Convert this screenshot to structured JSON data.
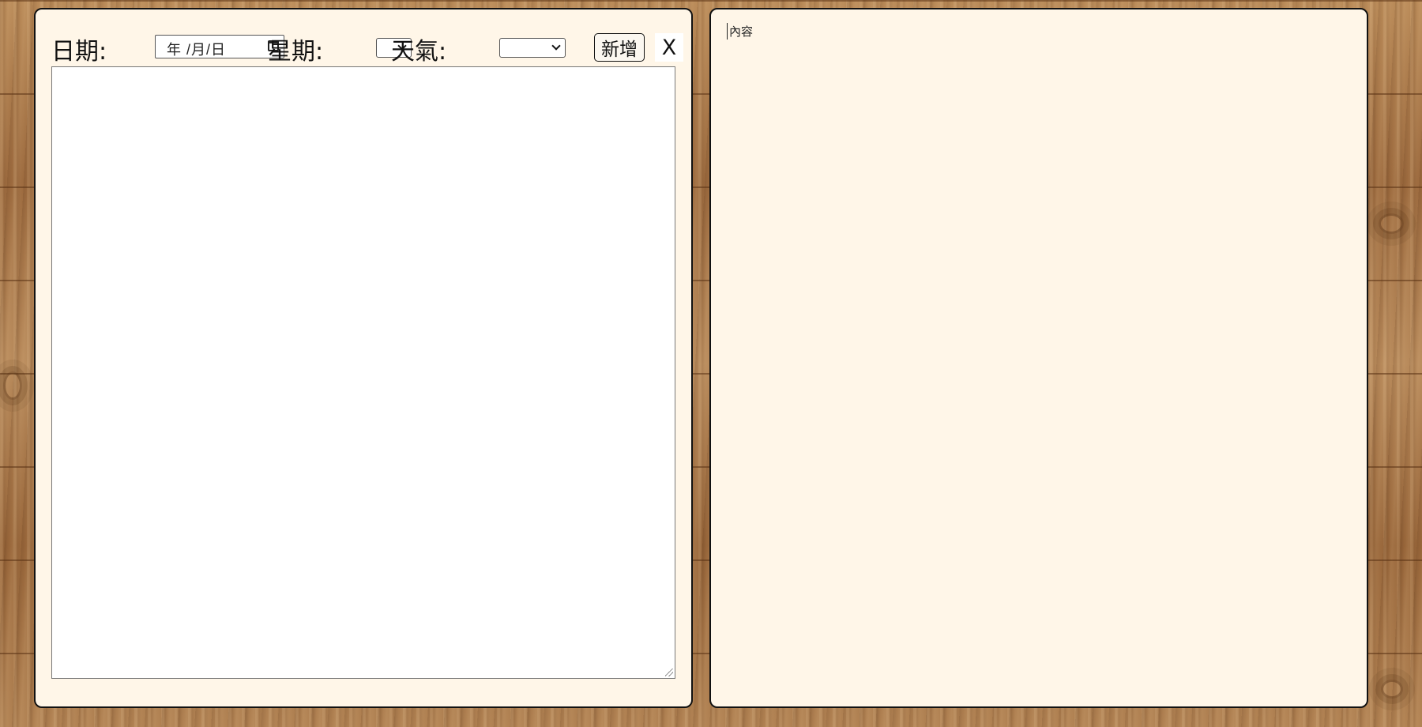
{
  "diary_form": {
    "date_label": "日期:",
    "date_placeholder": "年 /月/日",
    "weekday_label": "星期:",
    "weekday_selected": "",
    "weather_label": "天氣:",
    "weather_selected": "",
    "add_button_label": "新增",
    "close_button_label": "X",
    "editor_value": ""
  },
  "preview": {
    "content_label": "內容"
  },
  "icons": {
    "date_picker": "calendar-icon",
    "select_arrow": "chevron-down-icon",
    "textarea_resize": "resize-grip-icon"
  },
  "colors": {
    "panel_background": "#fff6e8",
    "panel_border": "#111111",
    "wood_background": "#a8774a"
  }
}
